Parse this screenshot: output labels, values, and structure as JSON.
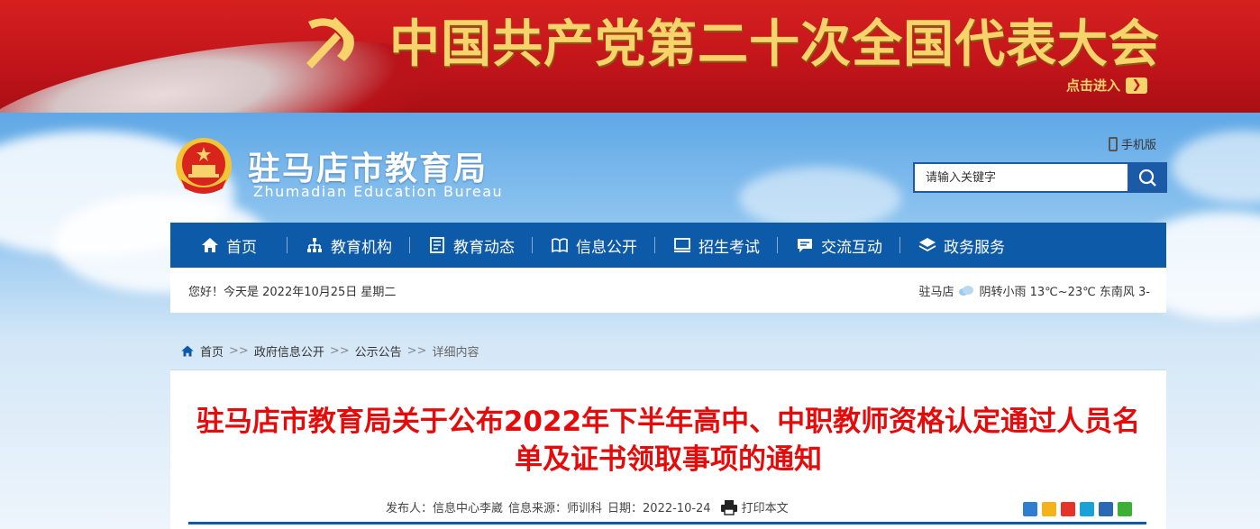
{
  "banner": {
    "title": "中国共产党第二十次全国代表大会",
    "enter_label": "点击进入"
  },
  "header": {
    "site_name": "驻马店市教育局",
    "site_name_en": "Zhumadian Education Bureau",
    "mobile_label": "手机版",
    "search_placeholder": "请输入关键字"
  },
  "nav": {
    "items": [
      {
        "label": "首页",
        "icon": "home-icon"
      },
      {
        "label": "教育机构",
        "icon": "org-chart-icon"
      },
      {
        "label": "教育动态",
        "icon": "news-icon"
      },
      {
        "label": "信息公开",
        "icon": "book-icon"
      },
      {
        "label": "招生考试",
        "icon": "monitor-icon"
      },
      {
        "label": "交流互动",
        "icon": "chat-icon"
      },
      {
        "label": "政务服务",
        "icon": "layers-icon"
      }
    ]
  },
  "infobar": {
    "greeting": "您好！今天是 2022年10月25日 星期二",
    "city": "驻马店",
    "weather": "阴转小雨 13℃~23℃ 东南风 3-"
  },
  "breadcrumb": {
    "home": "首页",
    "sep": ">>",
    "level1": "政府信息公开",
    "level2": "公示公告",
    "current": "详细内容"
  },
  "article": {
    "title": "驻马店市教育局关于公布2022年下半年高中、中职教师资格认定通过人员名单及证书领取事项的通知",
    "publisher": "发布人：信息中心李崴",
    "source": "信息来源：师训科",
    "date": "日期：2022-10-24",
    "print_label": "打印本文"
  },
  "colors": {
    "nav_bg": "#0d5aa8",
    "title_red": "#e60b0b",
    "banner_red": "#c0141a",
    "banner_gold": "#f6d36b"
  }
}
